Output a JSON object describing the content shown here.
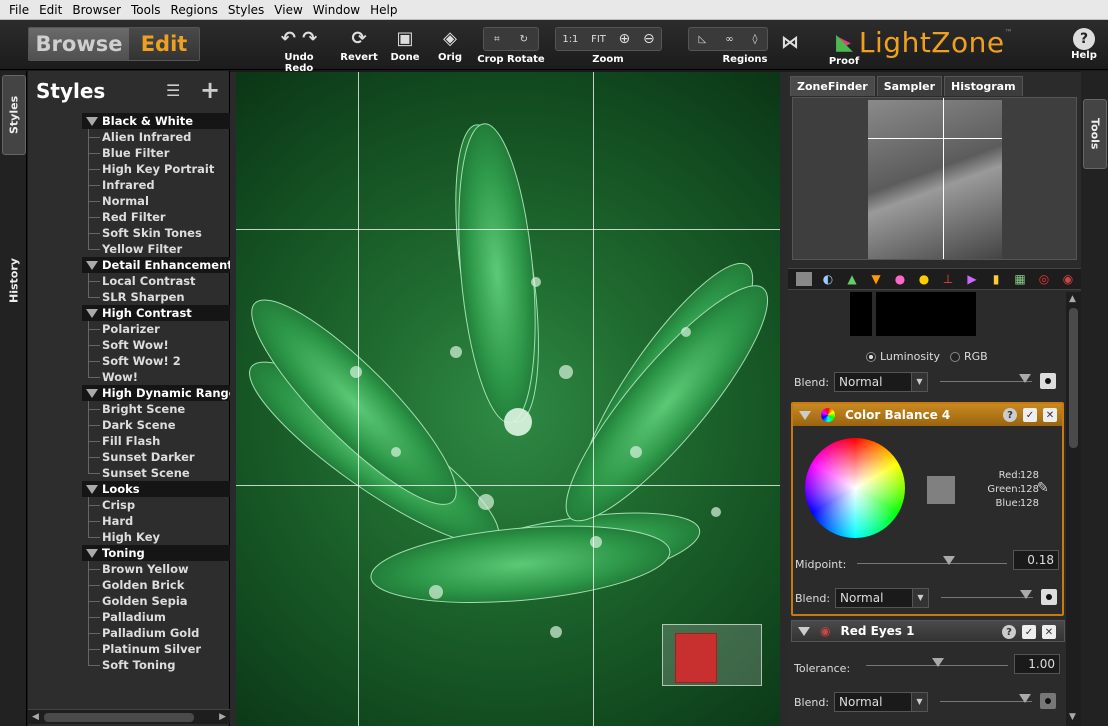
{
  "menu": [
    "File",
    "Edit",
    "Browser",
    "Tools",
    "Regions",
    "Styles",
    "View",
    "Window",
    "Help"
  ],
  "mode": {
    "browse": "Browse",
    "edit": "Edit"
  },
  "toolbar": {
    "undo_redo": "Undo Redo",
    "revert": "Revert",
    "done": "Done",
    "orig": "Orig",
    "crop_rotate": "Crop Rotate",
    "zoom": "Zoom",
    "zoom_1to1": "1:1",
    "zoom_fit": "FIT",
    "regions": "Regions",
    "proof": "Proof",
    "help": "Help"
  },
  "logo": {
    "text": "LightZone",
    "tm": "™"
  },
  "left_tabs": {
    "styles": "Styles",
    "history": "History"
  },
  "styles_panel": {
    "title": "Styles",
    "categories": [
      {
        "label": "Black & White",
        "items": [
          "Alien Infrared",
          "Blue Filter",
          "High Key Portrait",
          "Infrared",
          "Normal",
          "Red Filter",
          "Soft Skin Tones",
          "Yellow Filter"
        ]
      },
      {
        "label": "Detail Enhancement",
        "items": [
          "Local Contrast",
          "SLR Sharpen"
        ]
      },
      {
        "label": "High Contrast",
        "items": [
          "Polarizer",
          "Soft Wow!",
          "Soft Wow! 2",
          "Wow!"
        ]
      },
      {
        "label": "High Dynamic Range",
        "items": [
          "Bright Scene",
          "Dark Scene",
          "Fill Flash",
          "Sunset Darker",
          "Sunset Scene"
        ]
      },
      {
        "label": "Looks",
        "items": [
          "Crisp",
          "Hard",
          "High Key"
        ]
      },
      {
        "label": "Toning",
        "items": [
          "Brown Yellow",
          "Golden Brick",
          "Golden Sepia",
          "Palladium",
          "Palladium Gold",
          "Platinum Silver",
          "Soft Toning"
        ]
      }
    ]
  },
  "right_tabs": {
    "tools": "Tools"
  },
  "zone_tabs": [
    "ZoneFinder",
    "Sampler",
    "Histogram"
  ],
  "tools": {
    "top_tool": {
      "luminosity": "Luminosity",
      "rgb": "RGB",
      "blend_label": "Blend:",
      "blend_value": "Normal",
      "opacity": 0.92
    },
    "color_balance": {
      "title": "Color Balance 4",
      "red_label": "Red:",
      "red_value": "128",
      "green_label": "Green:",
      "green_value": "128",
      "blue_label": "Blue:",
      "blue_value": "128",
      "midpoint_label": "Midpoint:",
      "midpoint_value": "0.18",
      "blend_label": "Blend:",
      "blend_value": "Normal",
      "opacity": 0.92
    },
    "red_eyes": {
      "title": "Red Eyes 1",
      "tolerance_label": "Tolerance:",
      "tolerance_value": "1.00",
      "blend_label": "Blend:",
      "blend_value": "Normal",
      "opacity": 0.92
    }
  },
  "colors": {
    "accent": "#f0a020",
    "tool_border": "#c87a10"
  }
}
